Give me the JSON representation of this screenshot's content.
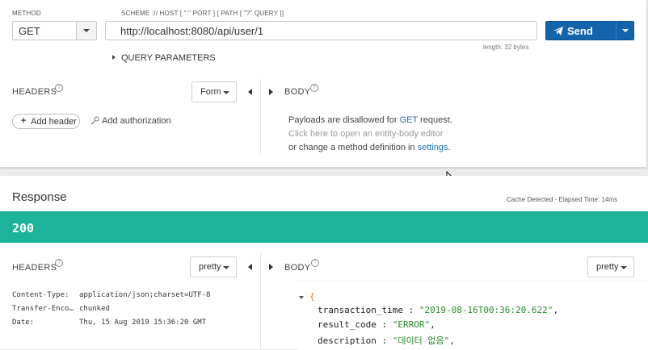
{
  "request": {
    "method_label": "METHOD",
    "method_value": "GET",
    "url_label": "SCHEME :// HOST [ \":\" PORT ] [ PATH [ \"?\" QUERY ]]",
    "url_value": "http://localhost:8080/api/user/1",
    "length_text": "length: 32 bytes",
    "send_label": "Send",
    "query_params_label": "QUERY PARAMETERS",
    "headers_label": "HEADERS",
    "headers_mode": "Form",
    "add_header_label": "Add header",
    "add_auth_label": "Add authorization",
    "body_label": "BODY",
    "body_message": {
      "line1_prefix": "Payloads are disallowed for ",
      "line1_method": "GET",
      "line1_suffix": " request.",
      "line2": "Click here to open an entity-body editor",
      "line3_prefix": "or change a method definition in ",
      "line3_link": "settings",
      "line3_suffix": "."
    }
  },
  "response": {
    "title": "Response",
    "meta": "Cache Detected - Elapsed Time: 14ms",
    "status_code": "200",
    "status_color": "#1bb49b",
    "headers_label": "HEADERS",
    "headers_mode": "pretty",
    "body_label": "BODY",
    "body_mode": "pretty",
    "headers": [
      {
        "name": "Content-Type:",
        "value": "application/json;charset=UTF-8"
      },
      {
        "name": "Transfer-Enco…",
        "value": "chunked"
      },
      {
        "name": "Date:",
        "value": "Thu, 15 Aug 2019 15:36:20 GMT"
      }
    ],
    "body_json": {
      "open_brace": "{",
      "lines": [
        {
          "key": "transaction_time",
          "value": "\"2019-08-16T00:36:20.622\""
        },
        {
          "key": "result_code",
          "value": "\"ERROR\""
        },
        {
          "key": "description",
          "value": "\"데이터 없음\""
        }
      ]
    }
  },
  "colors": {
    "accent": "#1463ad",
    "link": "#1a6fb5",
    "success": "#1bb49b",
    "json_string": "#2a8a2a",
    "json_brace": "#e08a00"
  }
}
